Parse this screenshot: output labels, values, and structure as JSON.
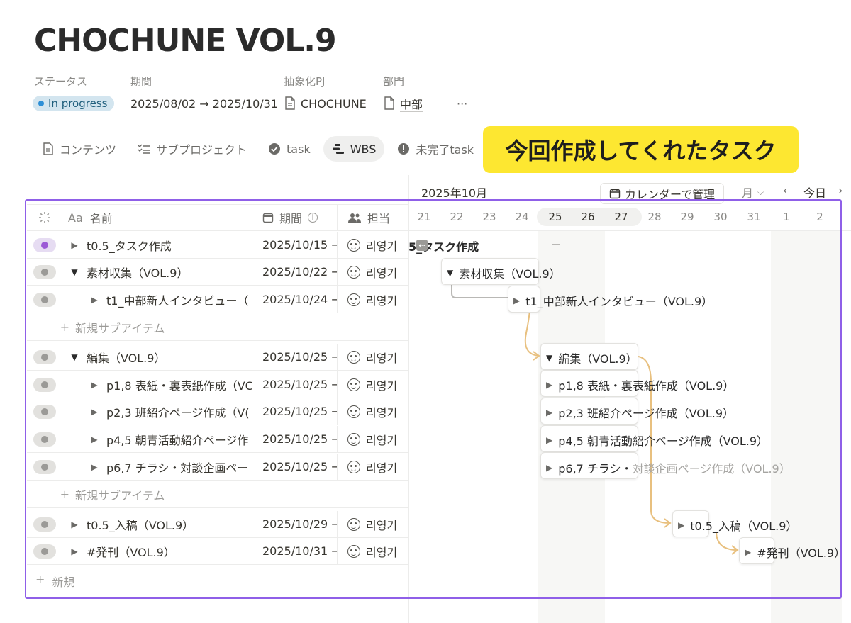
{
  "page": {
    "title": "CHOCHUNE VOL.9"
  },
  "properties": {
    "status_label": "ステータス",
    "status_value": "In progress",
    "period_label": "期間",
    "period_value": "2025/08/02 → 2025/10/31",
    "abstract_label": "抽象化PJ",
    "abstract_value": "CHOCHUNE",
    "dept_label": "部門",
    "dept_value": "中部",
    "more": "···"
  },
  "tabs": [
    {
      "label": "コンテンツ",
      "icon": "document-icon"
    },
    {
      "label": "サブプロジェクト",
      "icon": "checklist-icon"
    },
    {
      "label": "task",
      "icon": "check-circle-icon"
    },
    {
      "label": "WBS",
      "icon": "timeline-icon",
      "active": true
    },
    {
      "label": "未完了task",
      "icon": "alert-icon"
    }
  ],
  "callout": "今回作成してくれたタスク",
  "table": {
    "headers": {
      "status_icon": "loading-icon",
      "name": "名前",
      "name_prefix": "Aa",
      "period": "期間",
      "owner": "担当"
    },
    "rows": [
      {
        "name": "t0.5_タスク作成",
        "date": "2025/10/15 →",
        "owner": "리영기",
        "indent": 0,
        "expanded": false,
        "status_color": "#9c5ad6"
      },
      {
        "name": "素材収集（VOL.9）",
        "date": "2025/10/22 →",
        "owner": "리영기",
        "indent": 0,
        "expanded": true
      },
      {
        "name": "t1_中部新人インタビュー（",
        "date": "2025/10/24 →",
        "owner": "리영기",
        "indent": 1,
        "expanded": false
      },
      {
        "name": "編集（VOL.9）",
        "date": "2025/10/25 →",
        "owner": "리영기",
        "indent": 0,
        "expanded": true
      },
      {
        "name": "p1,8 表紙・裏表紙作成（VC",
        "date": "2025/10/25 →",
        "owner": "리영기",
        "indent": 1,
        "expanded": false
      },
      {
        "name": "p2,3 班紹介ページ作成（V(",
        "date": "2025/10/25 →",
        "owner": "리영기",
        "indent": 1,
        "expanded": false
      },
      {
        "name": "p4,5 朝青活動紹介ページ作",
        "date": "2025/10/25 →",
        "owner": "리영기",
        "indent": 1,
        "expanded": false
      },
      {
        "name": "p6,7 チラシ・対談企画ペー",
        "date": "2025/10/25 →",
        "owner": "리영기",
        "indent": 1,
        "expanded": false
      },
      {
        "name": "t0.5_入稿（VOL.9）",
        "date": "2025/10/29 →",
        "owner": "리영기",
        "indent": 0,
        "expanded": false
      },
      {
        "name": "#発刊（VOL.9）",
        "date": "2025/10/31 →",
        "owner": "리영기",
        "indent": 0,
        "expanded": false
      }
    ],
    "add_sub_item": "新規サブアイテム",
    "add_new": "新規"
  },
  "gantt": {
    "month": "2025年10月",
    "calendar_button": "カレンダーで管理",
    "view_select": "月",
    "today_button": "今日",
    "days": [
      "21",
      "22",
      "23",
      "24",
      "25",
      "26",
      "27",
      "28",
      "29",
      "30",
      "31",
      "1",
      "2"
    ],
    "bars": [
      {
        "label": "5_タスク作成"
      },
      {
        "label": "素材収集（VOL.9）"
      },
      {
        "label": "t1_中部新人インタビュー（VOL.9）"
      },
      {
        "label": "編集（VOL.9）"
      },
      {
        "label": "p1,8 表紙・裏表紙作成（VOL.9）"
      },
      {
        "label": "p2,3 班紹介ページ作成（VOL.9）"
      },
      {
        "label": "p4,5 朝青活動紹介ページ作成（VOL.9）"
      },
      {
        "label_a": "p6,7 チラシ・",
        "label_b": "対談企画ページ作成（VOL.9）"
      },
      {
        "label": "t0.5_入稿（VOL.9）"
      },
      {
        "label": "#発刊（VOL.9）"
      }
    ],
    "colors": {
      "dependency": "#e8c07f",
      "frame": "#8f5fe8",
      "callout": "#fde731"
    }
  }
}
